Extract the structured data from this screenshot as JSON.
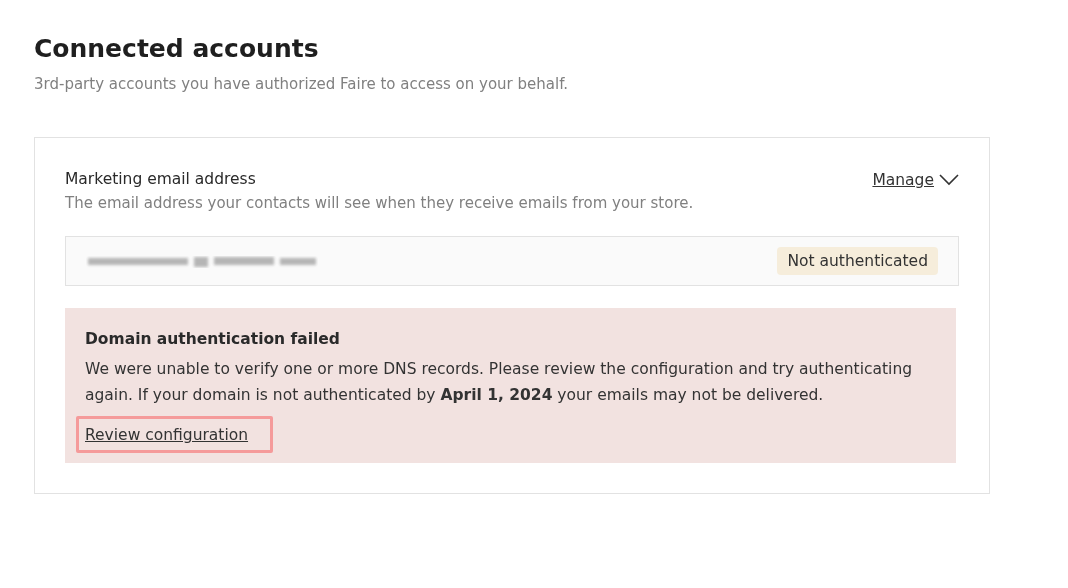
{
  "page": {
    "title": "Connected accounts",
    "subtitle": "3rd-party accounts you have authorized Faire to access on your behalf."
  },
  "account": {
    "title": "Marketing email address",
    "description": "The email address your contacts will see when they receive emails from your store.",
    "manage_link": "Manage",
    "status_badge": "Not authenticated"
  },
  "alert": {
    "title": "Domain authentication failed",
    "message": "We were unable to verify one or more DNS records. Please review the configuration and try authenticating again. If your domain is not authenticated by **April 1, 2024** your emails may not be delivered.",
    "link": "Review configuration",
    "highlighted": true
  }
}
